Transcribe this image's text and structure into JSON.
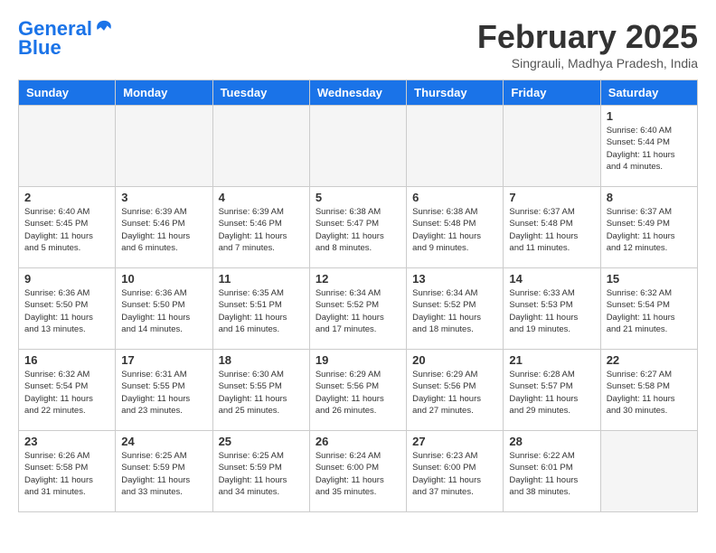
{
  "header": {
    "logo_line1": "General",
    "logo_line2": "Blue",
    "title": "February 2025",
    "subtitle": "Singrauli, Madhya Pradesh, India"
  },
  "days_of_week": [
    "Sunday",
    "Monday",
    "Tuesday",
    "Wednesday",
    "Thursday",
    "Friday",
    "Saturday"
  ],
  "weeks": [
    [
      {
        "day": "",
        "info": ""
      },
      {
        "day": "",
        "info": ""
      },
      {
        "day": "",
        "info": ""
      },
      {
        "day": "",
        "info": ""
      },
      {
        "day": "",
        "info": ""
      },
      {
        "day": "",
        "info": ""
      },
      {
        "day": "1",
        "info": "Sunrise: 6:40 AM\nSunset: 5:44 PM\nDaylight: 11 hours\nand 4 minutes."
      }
    ],
    [
      {
        "day": "2",
        "info": "Sunrise: 6:40 AM\nSunset: 5:45 PM\nDaylight: 11 hours\nand 5 minutes."
      },
      {
        "day": "3",
        "info": "Sunrise: 6:39 AM\nSunset: 5:46 PM\nDaylight: 11 hours\nand 6 minutes."
      },
      {
        "day": "4",
        "info": "Sunrise: 6:39 AM\nSunset: 5:46 PM\nDaylight: 11 hours\nand 7 minutes."
      },
      {
        "day": "5",
        "info": "Sunrise: 6:38 AM\nSunset: 5:47 PM\nDaylight: 11 hours\nand 8 minutes."
      },
      {
        "day": "6",
        "info": "Sunrise: 6:38 AM\nSunset: 5:48 PM\nDaylight: 11 hours\nand 9 minutes."
      },
      {
        "day": "7",
        "info": "Sunrise: 6:37 AM\nSunset: 5:48 PM\nDaylight: 11 hours\nand 11 minutes."
      },
      {
        "day": "8",
        "info": "Sunrise: 6:37 AM\nSunset: 5:49 PM\nDaylight: 11 hours\nand 12 minutes."
      }
    ],
    [
      {
        "day": "9",
        "info": "Sunrise: 6:36 AM\nSunset: 5:50 PM\nDaylight: 11 hours\nand 13 minutes."
      },
      {
        "day": "10",
        "info": "Sunrise: 6:36 AM\nSunset: 5:50 PM\nDaylight: 11 hours\nand 14 minutes."
      },
      {
        "day": "11",
        "info": "Sunrise: 6:35 AM\nSunset: 5:51 PM\nDaylight: 11 hours\nand 16 minutes."
      },
      {
        "day": "12",
        "info": "Sunrise: 6:34 AM\nSunset: 5:52 PM\nDaylight: 11 hours\nand 17 minutes."
      },
      {
        "day": "13",
        "info": "Sunrise: 6:34 AM\nSunset: 5:52 PM\nDaylight: 11 hours\nand 18 minutes."
      },
      {
        "day": "14",
        "info": "Sunrise: 6:33 AM\nSunset: 5:53 PM\nDaylight: 11 hours\nand 19 minutes."
      },
      {
        "day": "15",
        "info": "Sunrise: 6:32 AM\nSunset: 5:54 PM\nDaylight: 11 hours\nand 21 minutes."
      }
    ],
    [
      {
        "day": "16",
        "info": "Sunrise: 6:32 AM\nSunset: 5:54 PM\nDaylight: 11 hours\nand 22 minutes."
      },
      {
        "day": "17",
        "info": "Sunrise: 6:31 AM\nSunset: 5:55 PM\nDaylight: 11 hours\nand 23 minutes."
      },
      {
        "day": "18",
        "info": "Sunrise: 6:30 AM\nSunset: 5:55 PM\nDaylight: 11 hours\nand 25 minutes."
      },
      {
        "day": "19",
        "info": "Sunrise: 6:29 AM\nSunset: 5:56 PM\nDaylight: 11 hours\nand 26 minutes."
      },
      {
        "day": "20",
        "info": "Sunrise: 6:29 AM\nSunset: 5:56 PM\nDaylight: 11 hours\nand 27 minutes."
      },
      {
        "day": "21",
        "info": "Sunrise: 6:28 AM\nSunset: 5:57 PM\nDaylight: 11 hours\nand 29 minutes."
      },
      {
        "day": "22",
        "info": "Sunrise: 6:27 AM\nSunset: 5:58 PM\nDaylight: 11 hours\nand 30 minutes."
      }
    ],
    [
      {
        "day": "23",
        "info": "Sunrise: 6:26 AM\nSunset: 5:58 PM\nDaylight: 11 hours\nand 31 minutes."
      },
      {
        "day": "24",
        "info": "Sunrise: 6:25 AM\nSunset: 5:59 PM\nDaylight: 11 hours\nand 33 minutes."
      },
      {
        "day": "25",
        "info": "Sunrise: 6:25 AM\nSunset: 5:59 PM\nDaylight: 11 hours\nand 34 minutes."
      },
      {
        "day": "26",
        "info": "Sunrise: 6:24 AM\nSunset: 6:00 PM\nDaylight: 11 hours\nand 35 minutes."
      },
      {
        "day": "27",
        "info": "Sunrise: 6:23 AM\nSunset: 6:00 PM\nDaylight: 11 hours\nand 37 minutes."
      },
      {
        "day": "28",
        "info": "Sunrise: 6:22 AM\nSunset: 6:01 PM\nDaylight: 11 hours\nand 38 minutes."
      },
      {
        "day": "",
        "info": ""
      }
    ]
  ]
}
